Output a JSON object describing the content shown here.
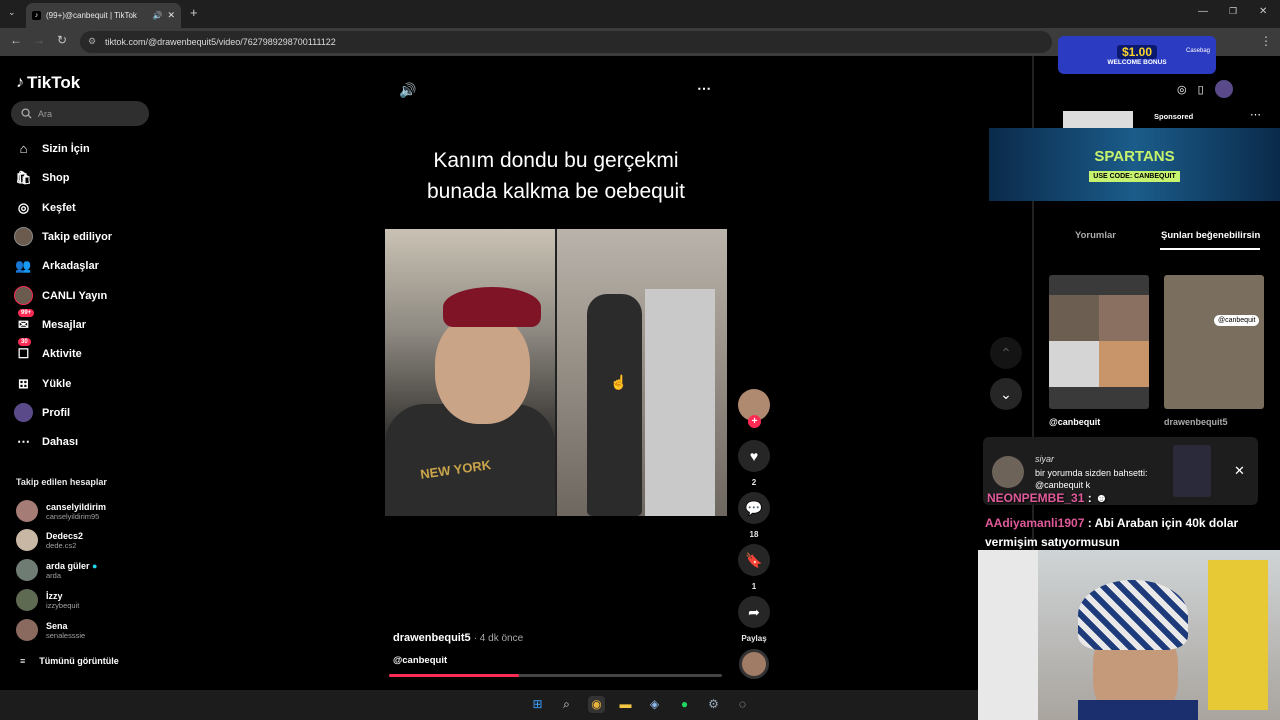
{
  "browser": {
    "tab_title": "(99+)@canbequit | TikTok",
    "url": "tiktok.com/@drawenbequit5/video/7627989298700111122"
  },
  "sidebar": {
    "logo": "TikTok",
    "search_placeholder": "Ara",
    "items": [
      {
        "label": "Sizin İçin",
        "icon": "home-icon"
      },
      {
        "label": "Shop",
        "icon": "shop-icon"
      },
      {
        "label": "Keşfet",
        "icon": "compass-icon"
      },
      {
        "label": "Takip ediliyor",
        "icon": "following-avatar"
      },
      {
        "label": "Arkadaşlar",
        "icon": "friends-icon"
      },
      {
        "label": "CANLI Yayın",
        "icon": "live-avatar"
      },
      {
        "label": "Mesajlar",
        "icon": "messages-icon",
        "badge": "99+"
      },
      {
        "label": "Aktivite",
        "icon": "activity-icon",
        "badge": "30"
      },
      {
        "label": "Yükle",
        "icon": "upload-icon"
      },
      {
        "label": "Profil",
        "icon": "profile-avatar"
      },
      {
        "label": "Dahası",
        "icon": "more-icon"
      }
    ],
    "following_title": "Takip edilen hesaplar",
    "accounts": [
      {
        "name": "canselyildirim",
        "username": "canselyildirim95"
      },
      {
        "name": "Dedecs2",
        "username": "dede.cs2"
      },
      {
        "name": "arda güler",
        "username": "arda"
      },
      {
        "name": "İzzy",
        "username": "izzybequit"
      },
      {
        "name": "Sena",
        "username": "senalesssie"
      }
    ],
    "see_all": "Tümünü görüntüle"
  },
  "video": {
    "caption_line1": "Kanım dondu bu gerçekmi",
    "caption_line2": "bunada kalkma be oebequit",
    "author": "drawenbequit5",
    "time": "4 dk önce",
    "mention": "@canbequit",
    "progress": 0.39,
    "jersey_text": "NEW YORK"
  },
  "actions": {
    "likes": "2",
    "comments": "18",
    "saves": "1",
    "share_label": "Paylaş"
  },
  "right_panel": {
    "sponsored": "Sponsored",
    "ad_brand": "SPARTANS",
    "ad_code": "USE CODE: CANBEQUIT",
    "promo_amount": "$1.00",
    "promo_label": "WELCOME BONUS",
    "promo_brand": "Casebag",
    "tab_comments": "Yorumlar",
    "tab_suggested": "Şunları beğenebilirsin",
    "thumb1_handle": "@canbequit",
    "thumb2_handle": "drawenbequit5",
    "thumb2_overlay": "@canbequit"
  },
  "notification": {
    "sender": "siyar",
    "text": "bir yorumda sizden bahsetti: @canbequit k"
  },
  "chat": [
    {
      "user": "NEONPEMBE_31",
      "message": ":"
    },
    {
      "user": "AAdiyamanli1907",
      "message": ": Abi Araban için 40k dolar vermişim satıyormusun"
    }
  ],
  "colors": {
    "accent": "#fe2c55",
    "chat_user": "#e05a9a"
  }
}
